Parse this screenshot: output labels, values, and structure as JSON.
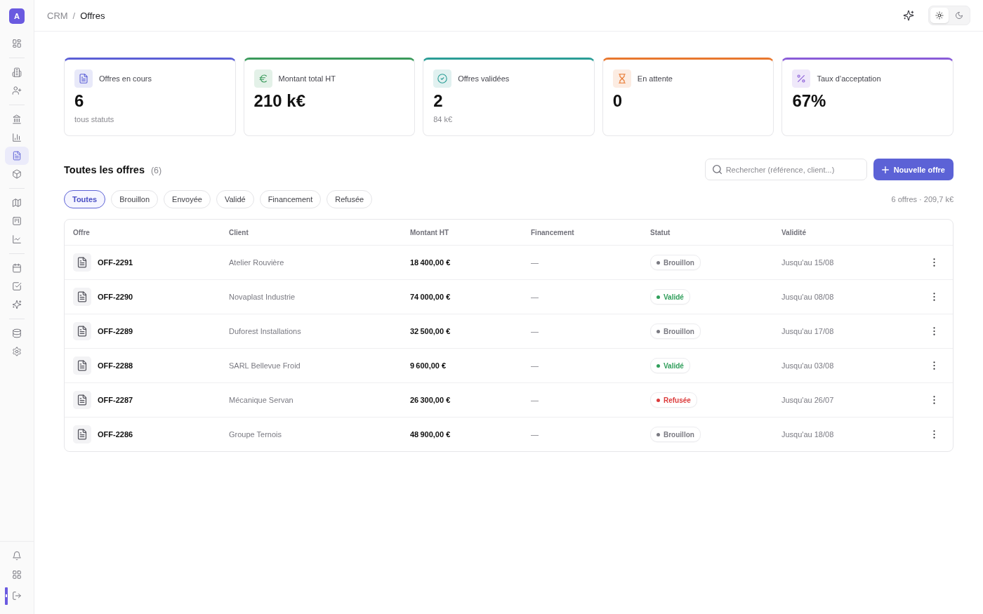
{
  "sidebar": {
    "logo": "A",
    "nav_groups": [
      {
        "items": [
          {
            "selected": false
          }
        ]
      },
      {
        "items": [
          {
            "selected": false
          },
          {
            "selected": false
          }
        ]
      },
      {
        "items": [
          {
            "selected": false
          },
          {
            "selected": false
          },
          {
            "selected": true
          },
          {
            "selected": false
          }
        ]
      },
      {
        "items": [
          {
            "selected": false
          },
          {
            "selected": false
          },
          {
            "selected": false
          }
        ]
      },
      {
        "items": [
          {
            "selected": false
          },
          {
            "selected": false
          },
          {
            "selected": false
          }
        ]
      },
      {
        "items": [
          {
            "selected": false
          },
          {
            "selected": false
          }
        ]
      }
    ]
  },
  "header": {
    "breadcrumb": {
      "items": [
        "CRM",
        "Offres"
      ],
      "separator": "/"
    },
    "theme_options": [
      {
        "selected": true
      },
      {
        "selected": false
      }
    ]
  },
  "kpis": [
    {
      "label": "Offres en cours",
      "value": "6",
      "note": "tous statuts",
      "color": "#5b5fd6"
    },
    {
      "label": "Montant total HT",
      "value": "210 k€",
      "color": "#3a9a5b"
    },
    {
      "label": "Offres validées",
      "value": "2",
      "note": "84 k€",
      "color": "#2a9d96"
    },
    {
      "label": "En attente",
      "value": "0",
      "color": "#e8772e"
    },
    {
      "label": "Taux d’acceptation",
      "value": "67%",
      "color": "#8a5cd8"
    }
  ],
  "offers": {
    "title": "Toutes les offres",
    "count": "(6)",
    "search": {
      "placeholder": "Rechercher (référence, client...)"
    },
    "new_button": "Nouvelle offre",
    "filters": [
      {
        "label": "Toutes",
        "selected": true
      },
      {
        "label": "Brouillon",
        "selected": false
      },
      {
        "label": "Envoyée",
        "selected": false
      },
      {
        "label": "Validé",
        "selected": false
      },
      {
        "label": "Financement",
        "selected": false
      },
      {
        "label": "Refusée",
        "selected": false
      }
    ],
    "summary": "6 offres · 209,7 k€"
  },
  "table": {
    "columns": [
      "Offre",
      "Client",
      "Montant HT",
      "Financement",
      "Statut",
      "Validité"
    ],
    "rows": [
      {
        "ref": "OFF-2291",
        "client": "Atelier Rouvière",
        "amount": "18 400,00 €",
        "financing": "—",
        "status": {
          "label": "Brouillon",
          "color": "#7a7a82"
        },
        "validity": "Jusqu'au 15/08"
      },
      {
        "ref": "OFF-2290",
        "client": "Novaplast Industrie",
        "amount": "74 000,00 €",
        "financing": "—",
        "status": {
          "label": "Validé",
          "color": "#2f9e5a"
        },
        "validity": "Jusqu'au 08/08"
      },
      {
        "ref": "OFF-2289",
        "client": "Duforest Installations",
        "amount": "32 500,00 €",
        "financing": "—",
        "status": {
          "label": "Brouillon",
          "color": "#7a7a82"
        },
        "validity": "Jusqu'au 17/08"
      },
      {
        "ref": "OFF-2288",
        "client": "SARL Bellevue Froid",
        "amount": "9 600,00 €",
        "financing": "—",
        "status": {
          "label": "Validé",
          "color": "#2f9e5a"
        },
        "validity": "Jusqu'au 03/08"
      },
      {
        "ref": "OFF-2287",
        "client": "Mécanique Servan",
        "amount": "26 300,00 €",
        "financing": "—",
        "status": {
          "label": "Refusée",
          "color": "#dc3b3b"
        },
        "validity": "Jusqu'au 26/07"
      },
      {
        "ref": "OFF-2286",
        "client": "Groupe Ternois",
        "amount": "48 900,00 €",
        "financing": "—",
        "status": {
          "label": "Brouillon",
          "color": "#7a7a82"
        },
        "validity": "Jusqu'au 18/08"
      }
    ]
  }
}
